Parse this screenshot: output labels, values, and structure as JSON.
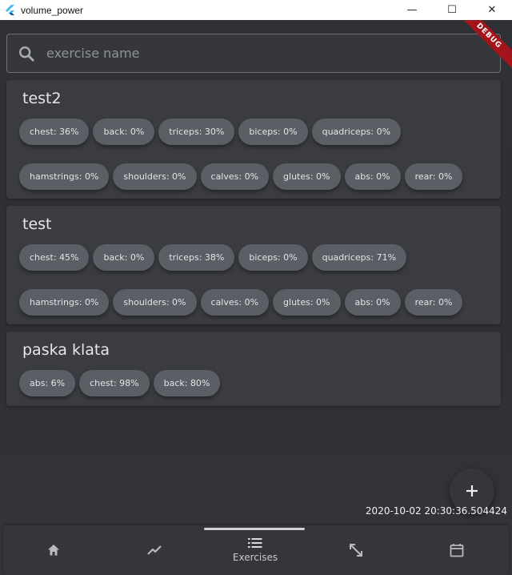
{
  "window": {
    "title": "volume_power",
    "controls": {
      "minimize": "—",
      "maximize": "☐",
      "close": "✕"
    }
  },
  "debug_banner": "DEBUG",
  "search": {
    "placeholder": "exercise name",
    "value": ""
  },
  "exercises": [
    {
      "name": "test2",
      "rows": [
        [
          "chest: 36%",
          "back: 0%",
          "triceps: 30%",
          "biceps: 0%",
          "quadriceps: 0%"
        ],
        [
          "hamstrings: 0%",
          "shoulders: 0%",
          "calves: 0%",
          "glutes: 0%",
          "abs: 0%",
          "rear: 0%"
        ]
      ]
    },
    {
      "name": "test",
      "rows": [
        [
          "chest: 45%",
          "back: 0%",
          "triceps: 38%",
          "biceps: 0%",
          "quadriceps: 71%"
        ],
        [
          "hamstrings: 0%",
          "shoulders: 0%",
          "calves: 0%",
          "glutes: 0%",
          "abs: 0%",
          "rear: 0%"
        ]
      ]
    },
    {
      "name": "paska klata",
      "rows": [
        [
          "abs: 6%",
          "chest: 98%",
          "back: 80%"
        ]
      ]
    }
  ],
  "fab": {
    "icon": "plus-icon"
  },
  "timestamp": "2020-10-02 20:30:36.504424",
  "bottom_nav": {
    "items": [
      {
        "icon": "home-icon",
        "label": ""
      },
      {
        "icon": "trend-icon",
        "label": ""
      },
      {
        "icon": "list-icon",
        "label": "Exercises"
      },
      {
        "icon": "expand-icon",
        "label": ""
      },
      {
        "icon": "calendar-icon",
        "label": ""
      }
    ],
    "selected_index": 2
  },
  "colors": {
    "background": "#2f3136",
    "card": "#3a3c41",
    "chip": "#5b5e64",
    "debug_banner": "#a3151b"
  }
}
